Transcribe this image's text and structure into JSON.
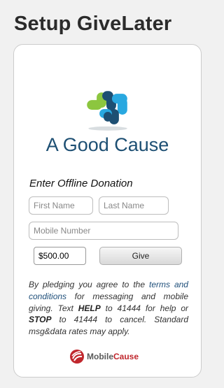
{
  "page": {
    "title": "Setup GiveLater"
  },
  "org": {
    "name": "A Good Cause"
  },
  "form": {
    "title": "Enter Offline Donation",
    "first_name_placeholder": "First Name",
    "last_name_placeholder": "Last Name",
    "mobile_placeholder": "Mobile Number",
    "amount_value": "$500.00",
    "give_label": "Give"
  },
  "disclaimer": {
    "part1": "By pledging you agree to the ",
    "link": "terms and conditions",
    "part2": " for messaging and mobile giving. Text ",
    "help_keyword": "HELP",
    "part3": " to 41444 for help or ",
    "stop_keyword": "STOP",
    "part4": " to 41444 to cancel. Standard msg&data rates may apply."
  },
  "brand": {
    "name_part1": "Mobile",
    "name_part2": "Cause"
  },
  "colors": {
    "org_blue": "#1d4f73",
    "logo_green": "#8cc63f",
    "logo_light_blue": "#29a8e0",
    "logo_dark": "#1d4f73",
    "brand_red": "#c0272d"
  }
}
